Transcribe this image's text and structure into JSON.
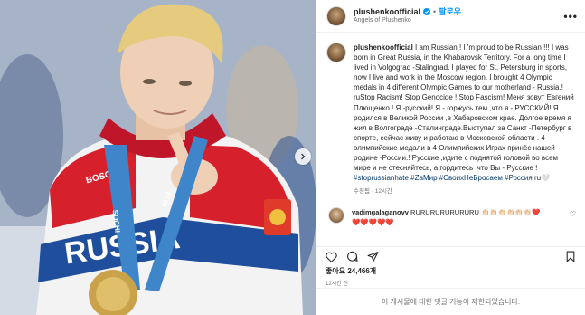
{
  "header": {
    "username": "plushenkoofficial",
    "follow_label": "팔로우",
    "separator": "•",
    "subtitle": "Angels of Plushenko",
    "more_label": "•••"
  },
  "caption": {
    "username": "plushenkoofficial",
    "text": "I am Russian ! I 'm proud to be Russian !!! I was born in Great Russia, in the Khabarovsk Territory. For a long time I lived in Volgograd -Stalingrad. I played for St. Petersburg in sports, now I live and work in the Moscow region. I brought 4 Olympic medals in 4 different Olympic Games to our motherland - Russia.! ruStop Racism! Stop Genocide ! Stop Fascism! Меня зовут Евгений Плющенко ! Я -русский! Я - горжусь тем ,что я - РУССКИЙ! Я родился в Великой России ,в Хабаровском крае. Долгое время я жил в Волгограде -Сталинграде.Выступал за Санкт -Петербург в спорте, сейчас живу и работаю в Московской области . 4 олимпийские медали в 4 Олимпийских Играх принёс нашей родине -России.! Русские ,идите с поднятой головой во всем мире и не стесняйтесь, а гордитесь ,что Вы - Русские !",
    "hashtags": "#stoprussianhate #ZаМир #СвоихНеБросаем #Россия",
    "trailing": "ru🤍",
    "meta": "수정됨 · 12시간"
  },
  "comment": {
    "username": "vadimgalaganovv",
    "text": "RURURURURURURU",
    "emojis": "👏🏻👏🏻👏🏻👏🏻👏🏻👏🏻❤️",
    "hearts_line": "❤️❤️❤️❤️❤️"
  },
  "likes": {
    "label": "좋아요",
    "count": "24,466개"
  },
  "date": "12시간 전",
  "restricted_notice": "이 게시물에 대한 댓글 기능이 제한되었습니다.",
  "media": {
    "sash_text_1": "SOCHI",
    "sash_text_2": "2014",
    "jacket_text": "RUSSIA",
    "brand_text": "BOSCO"
  },
  "colors": {
    "accent": "#0095f6",
    "link": "#00376b",
    "muted": "#737373",
    "red": "#d6202c",
    "blue": "#1f4f9c"
  }
}
